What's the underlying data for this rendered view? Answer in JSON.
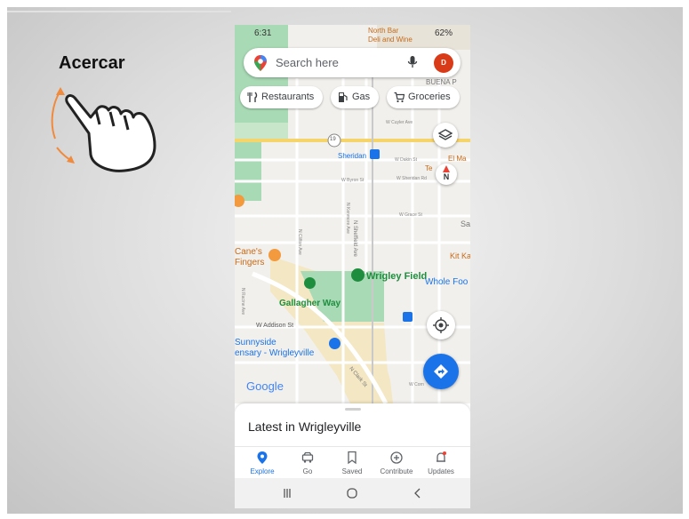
{
  "lesson": {
    "gesture_title": "Acercar"
  },
  "status": {
    "time": "6:31",
    "battery": "62%"
  },
  "search": {
    "placeholder": "Search here",
    "avatar_letter": "D"
  },
  "chips": [
    {
      "label": "Restaurants",
      "icon": "fork-knife-icon"
    },
    {
      "label": "Gas",
      "icon": "gas-pump-icon"
    },
    {
      "label": "Groceries",
      "icon": "cart-icon"
    }
  ],
  "map": {
    "labels": {
      "north_bar": "North Bar",
      "deli": "Deli and Wine",
      "buena_park": "BUENA P",
      "w_cuyler": "W Cuyler Ave",
      "sheridan_station": "Sheridan",
      "w_dakin": "W Dakin St",
      "w_sheridan_rd": "W Sheridan Rd",
      "w_byron": "W Byron St",
      "n_sheffield": "N Sheffield Ave",
      "n_kenmore": "N Kenmore Ave",
      "w_grace": "W Grace St",
      "n_clifton": "N Clifton Ave",
      "canes_1": "Cane's",
      "canes_2": "Fingers",
      "wrigley_field": "Wrigley Field",
      "whole_foods": "Whole Foo",
      "gallagher_way": "Gallagher Way",
      "n_racine": "N Racine Ave",
      "w_addison": "W Addison St",
      "sunnyside_1": "Sunnyside",
      "sunnyside_2": "ensary - Wrigleyville",
      "n_clark": "N Clark St",
      "w_cornelia": "W Corn",
      "google_logo": "Google",
      "edge_ma": "El Ma",
      "edge_te": "Te",
      "edge_sa": "Sa",
      "edge_kit": "Kit Ka",
      "route_num": "19",
      "compass_letter": "N"
    }
  },
  "sheet": {
    "title": "Latest in Wrigleyville"
  },
  "nav": [
    {
      "label": "Explore",
      "active": true
    },
    {
      "label": "Go",
      "active": false
    },
    {
      "label": "Saved",
      "active": false
    },
    {
      "label": "Contribute",
      "active": false
    },
    {
      "label": "Updates",
      "active": false
    }
  ],
  "colors": {
    "accent_blue": "#1a73e8",
    "park_green": "#a8dab5",
    "avatar_red": "#d93b18",
    "gesture_orange": "#f08a3c"
  }
}
